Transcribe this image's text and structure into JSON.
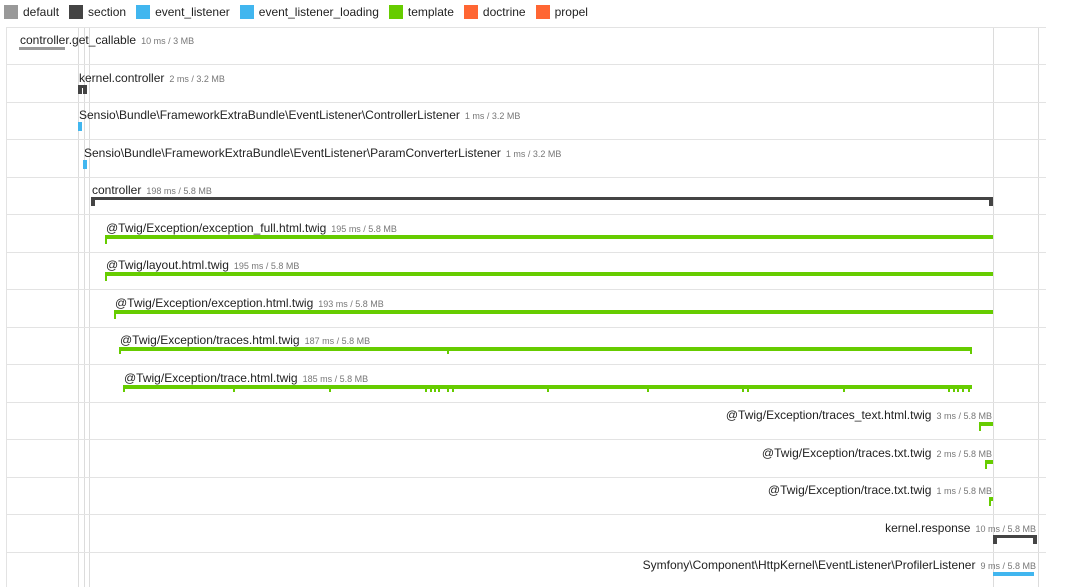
{
  "legend": [
    {
      "name": "default",
      "color": "#999999"
    },
    {
      "name": "section",
      "color": "#444444"
    },
    {
      "name": "event_listener",
      "color": "#41b6ef"
    },
    {
      "name": "event_listener_loading",
      "color": "#41b6ef"
    },
    {
      "name": "template",
      "color": "#66cc00"
    },
    {
      "name": "doctrine",
      "color": "#ff6633"
    },
    {
      "name": "propel",
      "color": "#ff6633"
    }
  ],
  "events": [
    {
      "name": "controller.get_callable",
      "meta": "10 ms / 3 MB",
      "category": "default"
    },
    {
      "name": "kernel.controller",
      "meta": "2 ms / 3.2 MB",
      "category": "section"
    },
    {
      "name": "Sensio\\Bundle\\FrameworkExtraBundle\\EventListener\\ControllerListener",
      "meta": "1 ms / 3.2 MB",
      "category": "event_listener"
    },
    {
      "name": "Sensio\\Bundle\\FrameworkExtraBundle\\EventListener\\ParamConverterListener",
      "meta": "1 ms / 3.2 MB",
      "category": "event_listener"
    },
    {
      "name": "controller",
      "meta": "198 ms / 5.8 MB",
      "category": "section"
    },
    {
      "name": "@Twig/Exception/exception_full.html.twig",
      "meta": "195 ms / 5.8 MB",
      "category": "template"
    },
    {
      "name": "@Twig/layout.html.twig",
      "meta": "195 ms / 5.8 MB",
      "category": "template"
    },
    {
      "name": "@Twig/Exception/exception.html.twig",
      "meta": "193 ms / 5.8 MB",
      "category": "template"
    },
    {
      "name": "@Twig/Exception/traces.html.twig",
      "meta": "187 ms / 5.8 MB",
      "category": "template"
    },
    {
      "name": "@Twig/Exception/trace.html.twig",
      "meta": "185 ms / 5.8 MB",
      "category": "template"
    },
    {
      "name": "@Twig/Exception/traces_text.html.twig",
      "meta": "3 ms / 5.8 MB",
      "category": "template"
    },
    {
      "name": "@Twig/Exception/traces.txt.twig",
      "meta": "2 ms / 5.8 MB",
      "category": "template"
    },
    {
      "name": "@Twig/Exception/trace.txt.twig",
      "meta": "1 ms / 5.8 MB",
      "category": "template"
    },
    {
      "name": "kernel.response",
      "meta": "10 ms / 5.8 MB",
      "category": "section"
    },
    {
      "name": "Symfony\\Component\\HttpKernel\\EventListener\\ProfilerListener",
      "meta": "9 ms / 5.8 MB",
      "category": "event_listener"
    }
  ]
}
